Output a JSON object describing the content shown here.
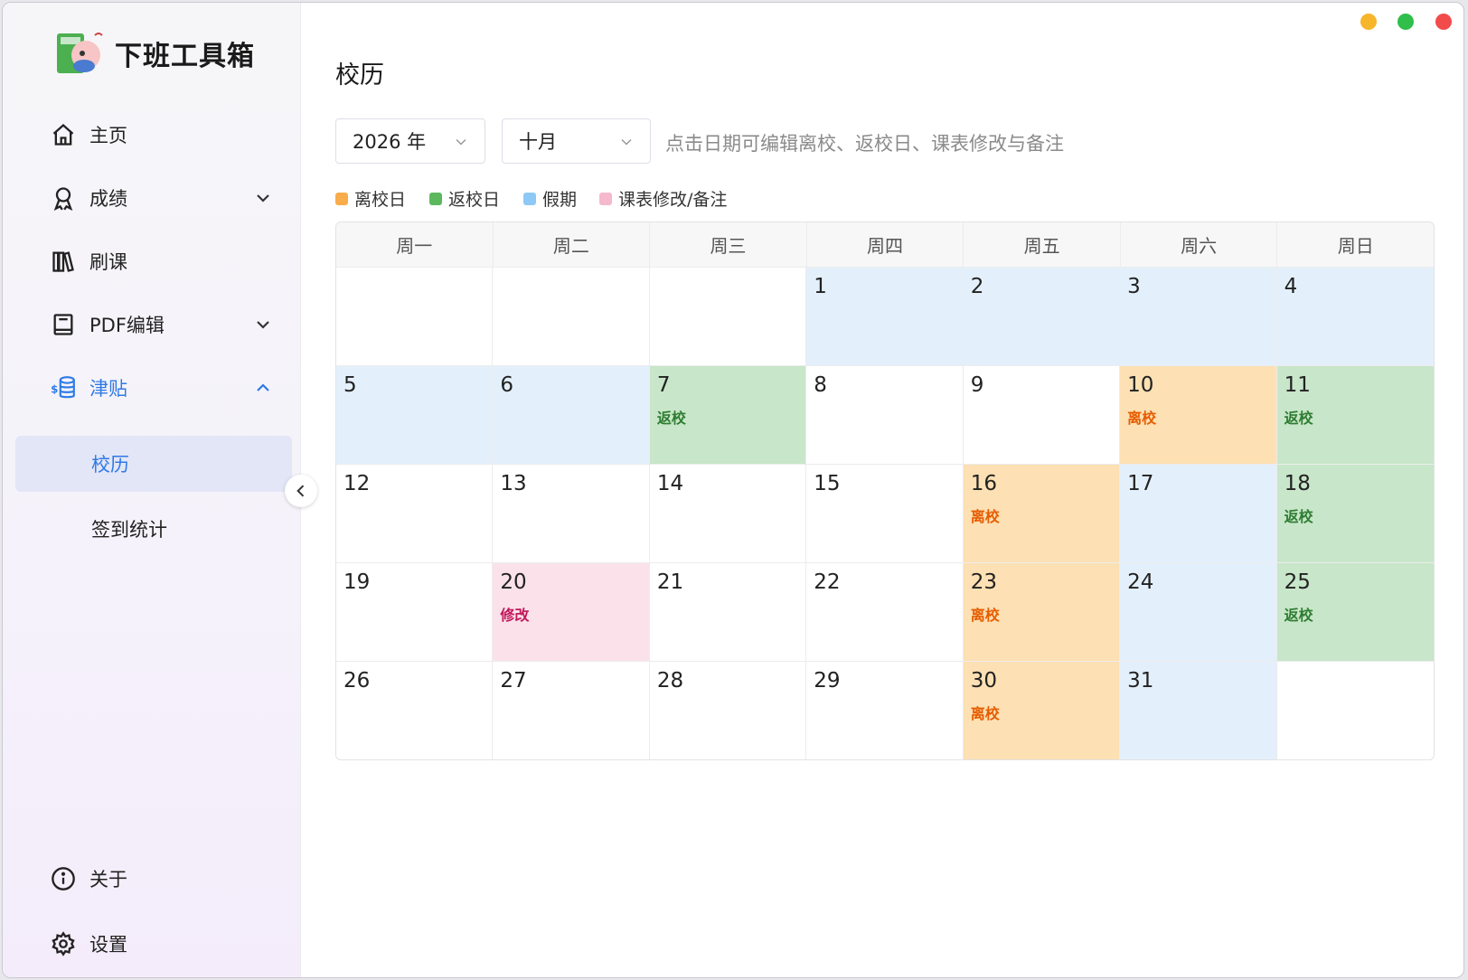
{
  "app": {
    "name": "下班工具箱"
  },
  "sidebar": {
    "items": [
      {
        "label": "主页"
      },
      {
        "label": "成绩"
      },
      {
        "label": "刷课"
      },
      {
        "label": "PDF编辑"
      },
      {
        "label": "津贴"
      }
    ],
    "sub_items": [
      {
        "label": "校历"
      },
      {
        "label": "签到统计"
      }
    ],
    "bottom": [
      {
        "label": "关于"
      },
      {
        "label": "设置"
      }
    ]
  },
  "window_controls": {
    "minimize_color": "#f7b52c",
    "maximize_color": "#2fbf4a",
    "close_color": "#f24b4b"
  },
  "page": {
    "title": "校历"
  },
  "filters": {
    "year": "2026 年",
    "month": "十月",
    "hint": "点击日期可编辑离校、返校日、课表修改与备注"
  },
  "legend": [
    {
      "label": "离校日",
      "color": "#f8ac4a"
    },
    {
      "label": "返校日",
      "color": "#5cb85c"
    },
    {
      "label": "假期",
      "color": "#8ec9f5"
    },
    {
      "label": "课表修改/备注",
      "color": "#f5b8cc"
    }
  ],
  "calendar": {
    "weekdays": [
      "周一",
      "周二",
      "周三",
      "周四",
      "周五",
      "周六",
      "周日"
    ],
    "weeks": [
      [
        {
          "day": "",
          "type": "none"
        },
        {
          "day": "",
          "type": "none"
        },
        {
          "day": "",
          "type": "none"
        },
        {
          "day": "1",
          "type": "holiday"
        },
        {
          "day": "2",
          "type": "holiday"
        },
        {
          "day": "3",
          "type": "holiday"
        },
        {
          "day": "4",
          "type": "holiday"
        }
      ],
      [
        {
          "day": "5",
          "type": "holiday"
        },
        {
          "day": "6",
          "type": "holiday"
        },
        {
          "day": "7",
          "type": "return",
          "tag": "返校"
        },
        {
          "day": "8",
          "type": "none"
        },
        {
          "day": "9",
          "type": "none"
        },
        {
          "day": "10",
          "type": "leave",
          "tag": "离校"
        },
        {
          "day": "11",
          "type": "return",
          "tag": "返校"
        }
      ],
      [
        {
          "day": "12",
          "type": "none"
        },
        {
          "day": "13",
          "type": "none"
        },
        {
          "day": "14",
          "type": "none"
        },
        {
          "day": "15",
          "type": "none"
        },
        {
          "day": "16",
          "type": "leave",
          "tag": "离校"
        },
        {
          "day": "17",
          "type": "holiday"
        },
        {
          "day": "18",
          "type": "return",
          "tag": "返校"
        }
      ],
      [
        {
          "day": "19",
          "type": "none"
        },
        {
          "day": "20",
          "type": "modify",
          "tag": "修改"
        },
        {
          "day": "21",
          "type": "none"
        },
        {
          "day": "22",
          "type": "none"
        },
        {
          "day": "23",
          "type": "leave",
          "tag": "离校"
        },
        {
          "day": "24",
          "type": "holiday"
        },
        {
          "day": "25",
          "type": "return",
          "tag": "返校"
        }
      ],
      [
        {
          "day": "26",
          "type": "none"
        },
        {
          "day": "27",
          "type": "none"
        },
        {
          "day": "28",
          "type": "none"
        },
        {
          "day": "29",
          "type": "none"
        },
        {
          "day": "30",
          "type": "leave",
          "tag": "离校"
        },
        {
          "day": "31",
          "type": "holiday"
        },
        {
          "day": "",
          "type": "none"
        }
      ]
    ]
  }
}
